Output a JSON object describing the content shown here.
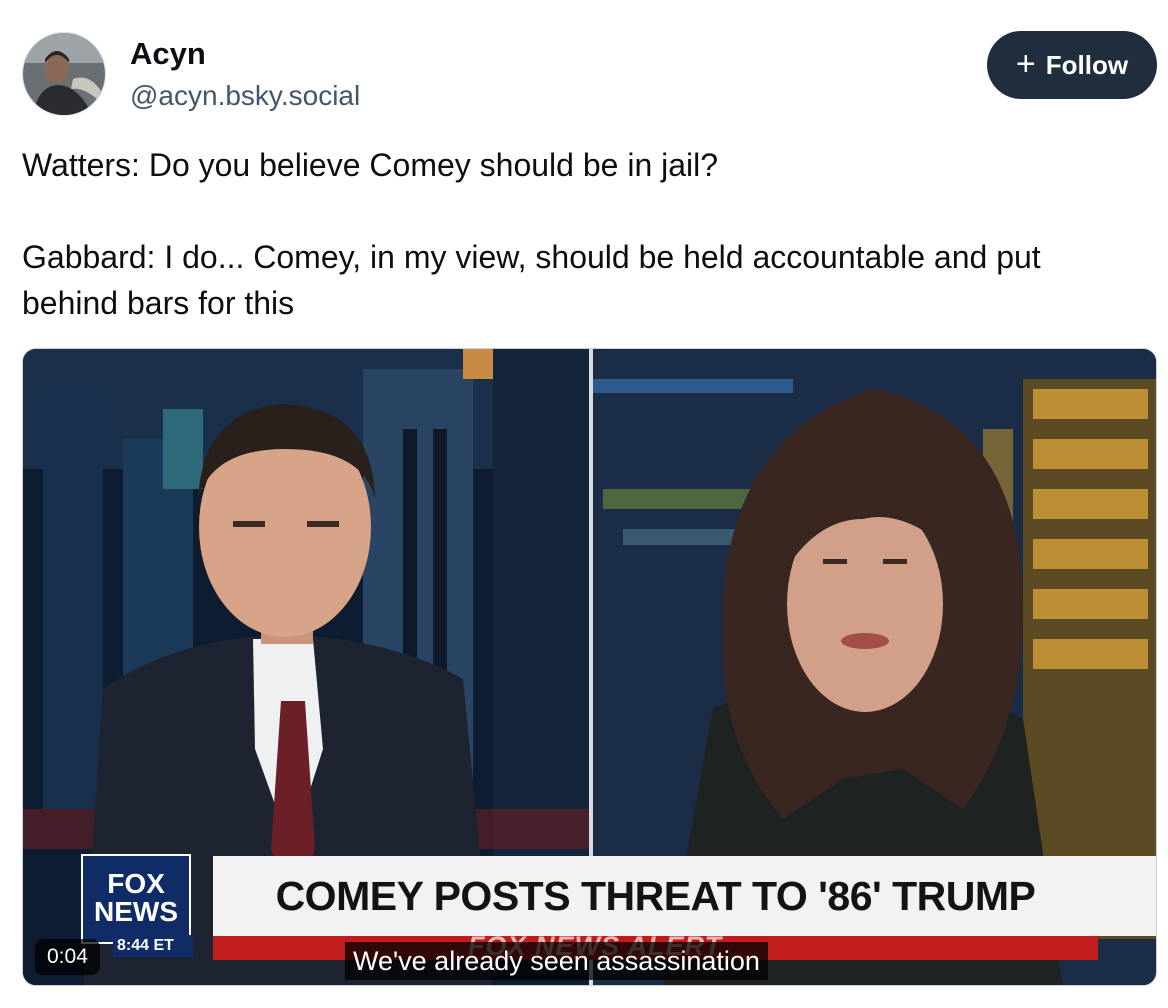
{
  "author": {
    "name": "Acyn",
    "handle": "@acyn.bsky.social"
  },
  "follow_button": {
    "icon": "plus-icon",
    "label": "Follow"
  },
  "post": {
    "lines": [
      "Watters: Do you believe Comey should be in jail?",
      "Gabbard: I do... Comey, in my view, should be held accountable and put behind bars for this"
    ]
  },
  "video": {
    "timestamp": "0:04",
    "caption": "We've already seen assassination",
    "chyron": "COMEY POSTS THREAT TO '86' TRUMP",
    "alert": "FOX NEWS ALERT",
    "logo_line1": "FOX",
    "logo_line2": "NEWS",
    "clock": "8:44 ET"
  },
  "colors": {
    "follow_bg": "#1f2d3c",
    "handle": "#42576c",
    "alert_red": "#c21d1d",
    "fox_blue": "#0f2c66"
  }
}
